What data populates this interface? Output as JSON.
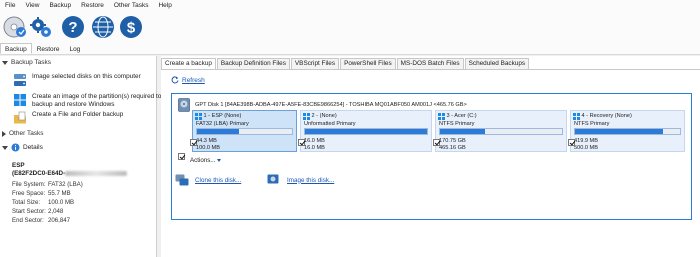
{
  "menu": [
    "File",
    "View",
    "Backup",
    "Restore",
    "Other Tasks",
    "Help"
  ],
  "toolbar": {
    "buttons": [
      {
        "name": "backup",
        "icon": "disk-backup-icon"
      },
      {
        "name": "settings",
        "icon": "gears-icon"
      },
      {
        "name": "help",
        "icon": "question-icon"
      },
      {
        "name": "web",
        "icon": "globe-icon"
      },
      {
        "name": "buy",
        "icon": "dollar-icon"
      }
    ],
    "tabs": [
      "Backup",
      "Restore",
      "Log"
    ],
    "active_tab": "Backup"
  },
  "left": {
    "backup_tasks_header": "Backup Tasks",
    "tasks": [
      {
        "icon": "disks-icon",
        "label": "Image selected disks on this computer"
      },
      {
        "icon": "windows-icon",
        "label": "Create an image of the partition(s) required to backup and restore Windows"
      },
      {
        "icon": "folder-file-icon",
        "label": "Create a File and Folder backup"
      }
    ],
    "other_tasks_header": "Other Tasks",
    "details_header": "Details",
    "details": {
      "name_line1": "ESP",
      "name_line2": "(E82F2DC0-E64D-",
      "rows": [
        {
          "label": "File System:",
          "value": "FAT32 (LBA)"
        },
        {
          "label": "Free Space:",
          "value": "55.7 MB"
        },
        {
          "label": "Total Size:",
          "value": "100.0 MB"
        },
        {
          "label": "Start Sector:",
          "value": "2,048"
        },
        {
          "label": "End Sector:",
          "value": "206,847"
        }
      ]
    }
  },
  "main": {
    "tabs": [
      "Create a backup",
      "Backup Definition Files",
      "VBScript Files",
      "PowerShell Files",
      "MS-DOS Batch Files",
      "Scheduled Backups"
    ],
    "active_tab": "Create a backup",
    "refresh_label": "Refresh",
    "disk": {
      "header": "GPT Disk 1 [84AE398B-ADBA-497E-A5FE-83CBE9866254] - TOSHIBA MQ01ABF050 AM001J  <465.76 GB>",
      "actions_label": "Actions...",
      "partitions": [
        {
          "title": "1 - ESP (None)",
          "fs": "FAT32 (LBA) Primary",
          "used": "44.3 MB",
          "total": "100.0 MB",
          "used_fraction": 0.443,
          "selected": true,
          "checked": true
        },
        {
          "title": "2 - (None)",
          "fs": "Unformatted Primary",
          "used": "16.0 MB",
          "total": "16.0 MB",
          "used_fraction": 1.0,
          "selected": false,
          "checked": true
        },
        {
          "title": "3 - Acer (C:)",
          "fs": "NTFS Primary",
          "used": "170.75 GB",
          "total": "465.16 GB",
          "used_fraction": 0.367,
          "selected": false,
          "checked": true
        },
        {
          "title": "4 - Recovery (None)",
          "fs": "NTFS Primary",
          "used": "419.9 MB",
          "total": "500.0 MB",
          "used_fraction": 0.84,
          "selected": false,
          "checked": true
        }
      ]
    },
    "clone_label": "Clone this disk...",
    "image_label": "Image this disk..."
  },
  "colors": {
    "accent": "#2c7bd6",
    "link": "#1a56b8",
    "partition_fill": "#cfe3f8"
  }
}
